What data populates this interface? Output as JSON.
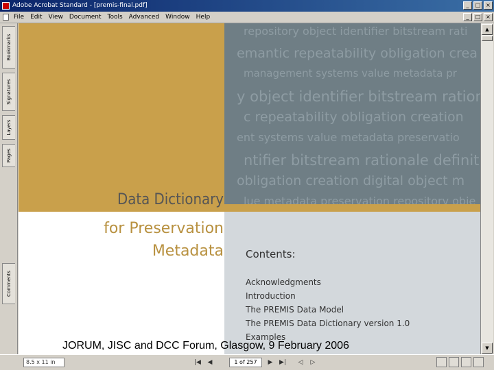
{
  "window": {
    "title": "Adobe Acrobat Standard - [premis-final.pdf]"
  },
  "menu": {
    "items": [
      "File",
      "Edit",
      "View",
      "Document",
      "Tools",
      "Advanced",
      "Window",
      "Help"
    ]
  },
  "sidebar": {
    "tabs": [
      "Bookmarks",
      "Signatures",
      "Layers",
      "Pages",
      "Comments"
    ]
  },
  "cover": {
    "word_cloud": [
      "repository object identifier bitstream rati",
      "emantic repeatability obligation crea",
      "management systems value metadata pr",
      "y object identifier bitstream rationale",
      "c repeatability obligation creation",
      "ent systems value metadata preservatio",
      "ntifier bitstream rationale definition se",
      "obligation creation digital object m",
      "lue metadata preservation repository obje"
    ],
    "title": "Data Dictionary",
    "subtitle_line1": "for Preservation",
    "subtitle_line2": "Metadata",
    "contents_heading": "Contents:",
    "contents": [
      "Acknowledgments",
      "Introduction",
      "The PREMIS Data Model",
      "The PREMIS Data Dictionary version 1.0",
      "Examples"
    ]
  },
  "statusbar": {
    "zoom": "8.5 x 11 in",
    "page_indicator": "1 of 257"
  },
  "footer": {
    "text": "JORUM, JISC and DCC Forum, Glasgow, 9 February 2006"
  },
  "colors": {
    "gold": "#c9a04b",
    "slate": "#6f7e85",
    "titlebar": "#0a246a"
  }
}
